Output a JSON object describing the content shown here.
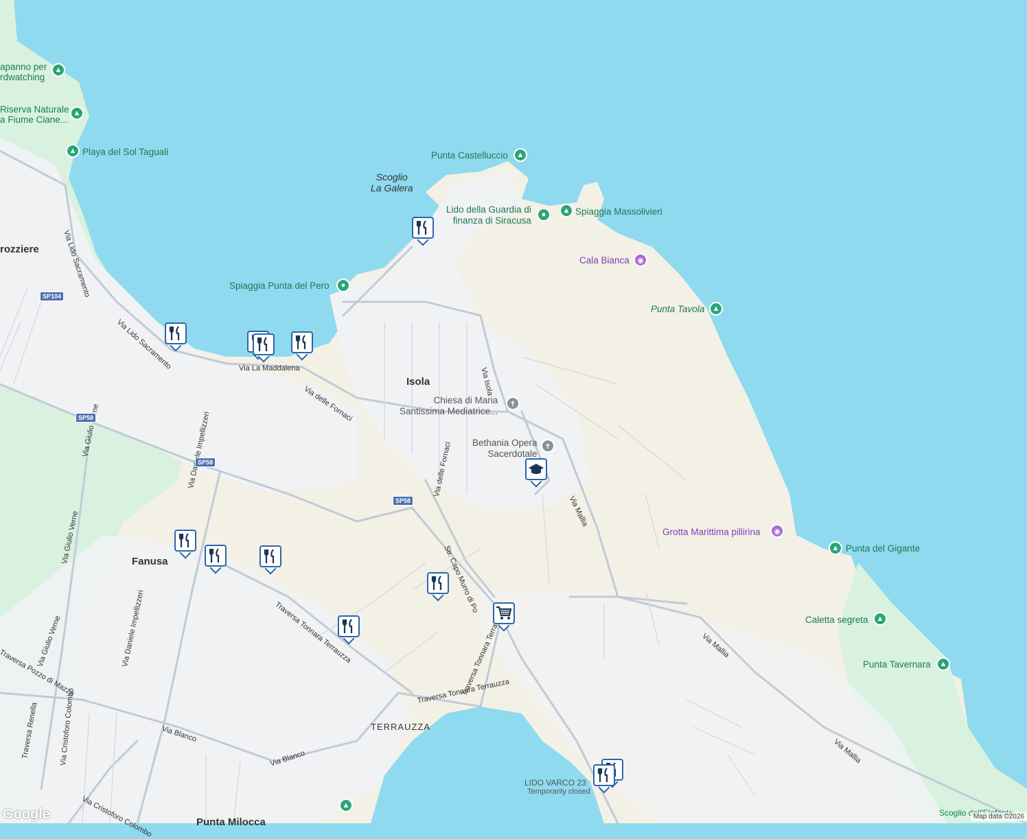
{
  "colors": {
    "water": "#8fdaee",
    "land": "#f3f0e6",
    "urban": "#f1f2f4",
    "green": "#d8f2df",
    "road": "#c2cad6",
    "pin_border": "#2b66a8"
  },
  "places": {
    "isola": "Isola",
    "fanusa": "Fanusa",
    "terrauzza": "TERRAUZZA",
    "carrozziere": "rozziere",
    "punta_milocca": "Punta Milocca",
    "scoglio": "Scoglio\nLa Galera"
  },
  "pois": {
    "capanno": "apanno per\nrdwatching",
    "riserva": "Riserva Naturale\na Fiume Ciane...",
    "playa": "Playa del Sol Taguali",
    "castelluccio": "Punta Castelluccio",
    "lido_guardia": "Lido della Guardia di\nfinanza di Siracusa",
    "massolivieri": "Spiaggia Massolivieri",
    "cala_bianca": "Cala Bianca",
    "punta_tavola": "Punta Tavola",
    "punta_pero": "Spiaggia Punta del Pero",
    "chiesa": "Chiesa di Maria\nSantissima Mediatrice...",
    "bethania": "Bethania Opera\nSacerdotale",
    "grotta": "Grotta Marittima pillirina",
    "gigante": "Punta del Gigante",
    "caletta": "Caletta segreta",
    "tavernara": "Punta Tavernara",
    "lido_varco": "LIDO VARCO 23",
    "temp_closed": "Temporarily closed",
    "elefante": "Scoglio dell'Elefante"
  },
  "roads": {
    "lido_sacramento_1": "Via Lido Sacramento",
    "lido_sacramento_2": "Via Lido Sacramento",
    "la_maddalena": "Via La Maddalena",
    "fornaci_1": "Via delle Fornaci",
    "fornaci_2": "Via delle Fornaci",
    "isola": "Via Isola",
    "mallia_1": "Via Mallia",
    "mallia_2": "Via Mallia",
    "mallia_3": "Via Mallia",
    "capo_murro_1": "Str. Capo Murro di Porco",
    "capo_murro_2": "Str. Capo Murro di Po",
    "impellizzeri_1": "Via Daniele Impellizzeri",
    "impellizzeri_2": "Via Daniele Impellizzeri",
    "giulio_verne_1": "Via Giulio Verne",
    "giulio_verne_2": "Via Giulio Verne",
    "giulio_verne_3": "Via Giulio Verne",
    "tonnara_1": "Traversa Tonnara Terrauzza",
    "tonnara_2": "Traversa Tonnara Terrauzza",
    "tonnara_3": "Traversa Tonnara Terrauzza",
    "pozzo": "Traversa Pozzo di Mazza",
    "renella": "Traversa Renella",
    "colombo_1": "Via Cristoforo Colombo",
    "colombo_2": "Via Cristoforo Colombo",
    "blanco_1": "Via Blanco",
    "blanco_2": "Via Blanco"
  },
  "shields": {
    "sp104": "SP104",
    "sp58_a": "SP58",
    "sp58_b": "SP58",
    "sp58_c": "SP58"
  },
  "footer": {
    "google": "Google",
    "attribution": "Map data ©2026"
  }
}
